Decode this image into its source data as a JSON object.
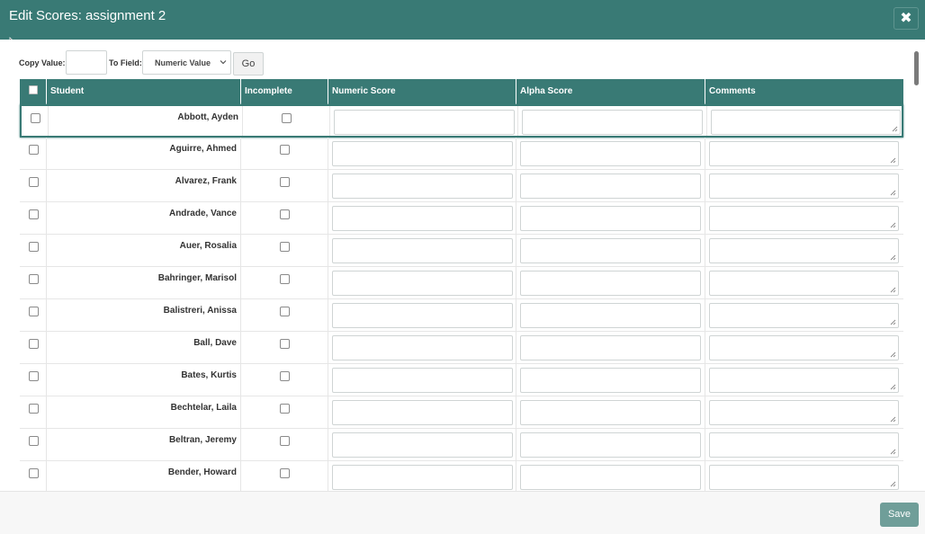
{
  "dialog": {
    "title": "Edit Scores: assignment 2",
    "close_glyph": "✖",
    "colors": {
      "header": "#397a75",
      "save_button": "#6f9e99"
    }
  },
  "copy_bar": {
    "copy_value_label": "Copy Value:",
    "copy_value": "",
    "to_field_label": "To Field:",
    "to_field_selected": "Numeric Value",
    "go_label": "Go"
  },
  "table": {
    "headers": {
      "student": "Student",
      "incomplete": "Incomplete",
      "numeric_score": "Numeric Score",
      "alpha_score": "Alpha Score",
      "comments": "Comments"
    },
    "rows": [
      {
        "student": "Abbott, Ayden"
      },
      {
        "student": "Aguirre, Ahmed"
      },
      {
        "student": "Alvarez, Frank"
      },
      {
        "student": "Andrade, Vance"
      },
      {
        "student": "Auer, Rosalia"
      },
      {
        "student": "Bahringer, Marisol"
      },
      {
        "student": "Balistreri, Anissa"
      },
      {
        "student": "Ball, Dave"
      },
      {
        "student": "Bates, Kurtis"
      },
      {
        "student": "Bechtelar, Laila"
      },
      {
        "student": "Beltran, Jeremy"
      },
      {
        "student": "Bender, Howard"
      }
    ]
  },
  "footer": {
    "save_label": "Save"
  }
}
